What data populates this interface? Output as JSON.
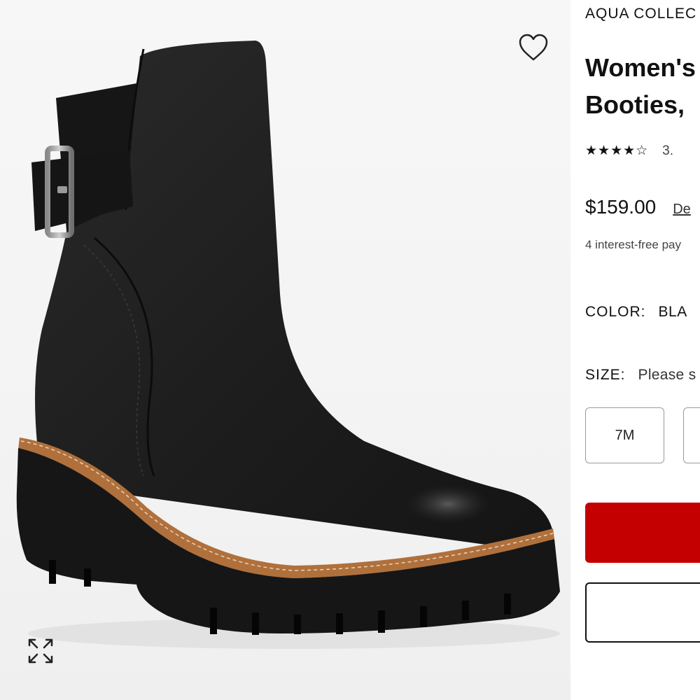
{
  "product": {
    "brand": "AQUA COLLEC",
    "title_line1": "Women's",
    "title_line2": "Booties,",
    "stars": "★★★★☆",
    "rating": "3.",
    "price": "$159.00",
    "deal_link": "De",
    "installment": "4 interest-free pay",
    "color_label": "COLOR:",
    "color_value": "BLA",
    "size_label": "SIZE:",
    "size_value": "Please s",
    "sizes": [
      "7M"
    ]
  },
  "icons": {
    "wishlist": "heart-outline-icon",
    "zoom": "expand-arrows-icon"
  },
  "colors": {
    "primary_button": "#c40000",
    "welt": "#b0703c",
    "boot": "#1c1c1c"
  }
}
